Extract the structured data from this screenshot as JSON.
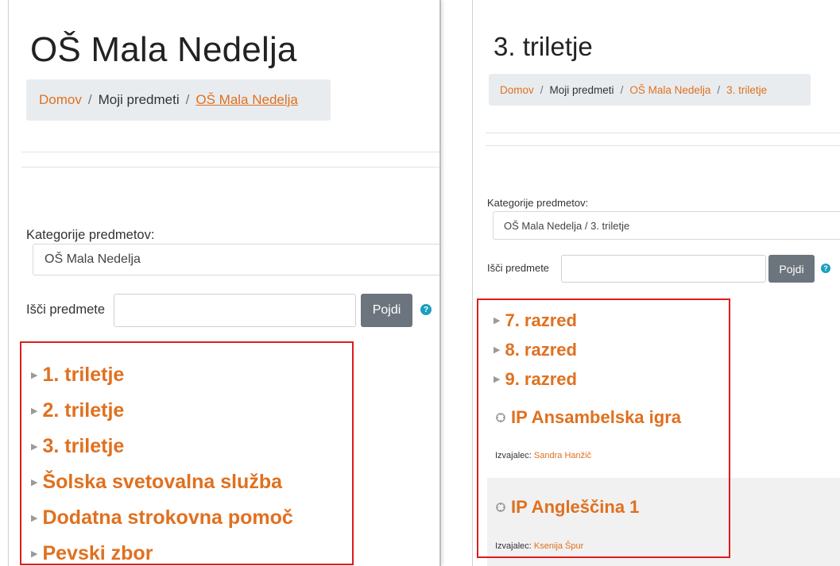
{
  "left": {
    "title": "OŠ Mala Nedelja",
    "breadcrumb": [
      "Domov",
      "Moji predmeti",
      "OŠ Mala Nedelja"
    ],
    "category_label": "Kategorije predmetov:",
    "category_value": "OŠ Mala Nedelja",
    "search_label": "Išči predmete",
    "search_placeholder": "",
    "search_button": "Pojdi",
    "help_glyph": "?",
    "categories": [
      "1. triletje",
      "2. triletje",
      "3. triletje",
      "Šolska svetovalna služba",
      "Dodatna strokovna pomoč",
      "Pevski zbor"
    ]
  },
  "right": {
    "title": "3. triletje",
    "breadcrumb": [
      "Domov",
      "Moji predmeti",
      "OŠ Mala Nedelja",
      "3. triletje"
    ],
    "category_label": "Kategorije predmetov:",
    "category_value": "OŠ Mala Nedelja / 3. triletje",
    "search_label": "Išči predmete",
    "search_placeholder": "",
    "search_button": "Pojdi",
    "help_glyph": "?",
    "categories": [
      "7. razred",
      "8. razred",
      "9. razred"
    ],
    "courses": [
      {
        "title": "IP Ansambelska igra",
        "teacher_label": "Izvajalec:",
        "teacher_name": "Sandra Hanžič"
      },
      {
        "title": "IP Angleščina 1",
        "teacher_label": "Izvajalec:",
        "teacher_name": "Ksenija Špur"
      }
    ]
  },
  "colors": {
    "link": "#e0701f",
    "breadcrumb_bg": "#e9ecef",
    "button_bg": "#6c757d",
    "help_bg": "#1aa0bd",
    "highlight_border": "#e01b1b"
  },
  "icons": {
    "expand": "triangle-right-icon",
    "course": "course-icon",
    "help": "question-circle-icon"
  }
}
